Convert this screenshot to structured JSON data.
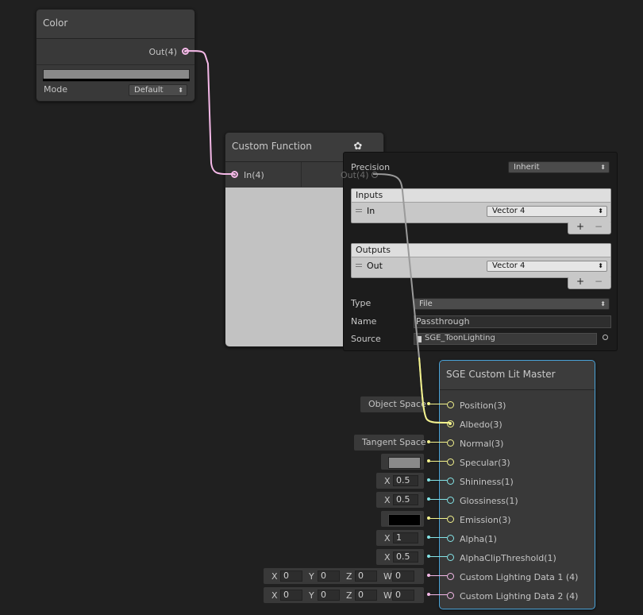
{
  "color_node": {
    "title": "Color",
    "output_label": "Out(4)",
    "mode_label": "Mode",
    "mode_value": "Default",
    "swatch_color": "#8a8a8a"
  },
  "custom_function_node": {
    "title": "Custom Function",
    "input_label": "In(4)",
    "output_label": "Out(4)",
    "gear_icon": "gear-icon"
  },
  "inspector": {
    "precision_label": "Precision",
    "precision_value": "Inherit",
    "inputs_header": "Inputs",
    "inputs_row_name": "In",
    "inputs_row_type": "Vector 4",
    "outputs_header": "Outputs",
    "outputs_row_name": "Out",
    "outputs_row_type": "Vector 4",
    "plus": "+",
    "minus": "−",
    "type_label": "Type",
    "type_value": "File",
    "name_label": "Name",
    "name_value": "Passthrough",
    "source_label": "Source",
    "source_value": "SGE_ToonLighting"
  },
  "master_node": {
    "title": "SGE Custom Lit Master",
    "ports": [
      "Position(3)",
      "Albedo(3)",
      "Normal(3)",
      "Specular(3)",
      "Shininess(1)",
      "Glossiness(1)",
      "Emission(3)",
      "Alpha(1)",
      "AlphaClipThreshold(1)",
      "Custom Lighting Data 1 (4)",
      "Custom Lighting Data 2 (4)"
    ]
  },
  "inline_inputs": {
    "position": "Object Space",
    "normal": "Tangent Space",
    "specular_color": "#8a8a8a",
    "shininess_axis": "X",
    "shininess": "0.5",
    "glossiness_axis": "X",
    "glossiness": "0.5",
    "emission_color": "#000000",
    "alpha_axis": "X",
    "alpha": "1",
    "clip_axis": "X",
    "clip": "0.5",
    "vec_axes": [
      "X",
      "Y",
      "Z",
      "W"
    ],
    "data1": [
      "0",
      "0",
      "0",
      "0"
    ],
    "data2": [
      "0",
      "0",
      "0",
      "0"
    ]
  },
  "colors": {
    "vector4": "#f5b9e8",
    "vector3": "#f3f28c",
    "vector1": "#84e4e7",
    "selection": "#4aa3d8",
    "graph_background": "#202020"
  }
}
